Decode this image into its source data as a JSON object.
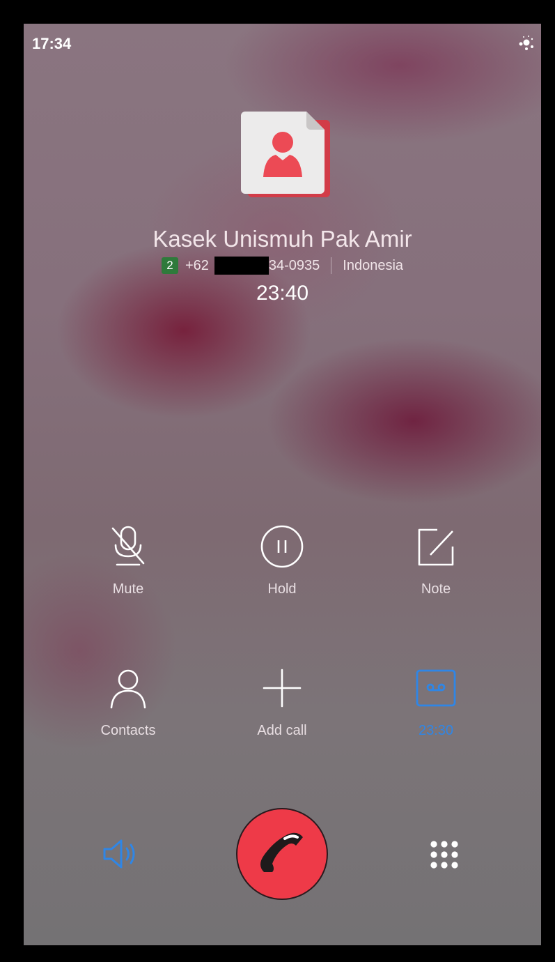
{
  "status_bar": {
    "time": "17:34",
    "status_icon": "activity-dots-icon"
  },
  "caller": {
    "avatar_icon": "contact-avatar-icon",
    "name": "Kasek Unismuh Pak Amir",
    "sim_slot": "2",
    "number_prefix": "+62",
    "number_suffix": "34-0935",
    "region": "Indonesia",
    "duration": "23:40"
  },
  "actions": {
    "mute": {
      "label": "Mute",
      "icon": "mic-off-icon"
    },
    "hold": {
      "label": "Hold",
      "icon": "pause-icon"
    },
    "note": {
      "label": "Note",
      "icon": "note-edit-icon"
    },
    "contacts": {
      "label": "Contacts",
      "icon": "person-icon"
    },
    "add_call": {
      "label": "Add call",
      "icon": "plus-icon"
    },
    "record": {
      "label": "23:30",
      "icon": "recording-tape-icon"
    }
  },
  "bottom_bar": {
    "speaker_icon": "speaker-icon",
    "end_call_icon": "end-call-icon",
    "dialpad_icon": "dialpad-icon"
  },
  "colors": {
    "end_call": "#ee3a48",
    "active_blue": "#2f86e6",
    "sim_badge": "#2f7a3b",
    "avatar_accent": "#ec4a55"
  }
}
